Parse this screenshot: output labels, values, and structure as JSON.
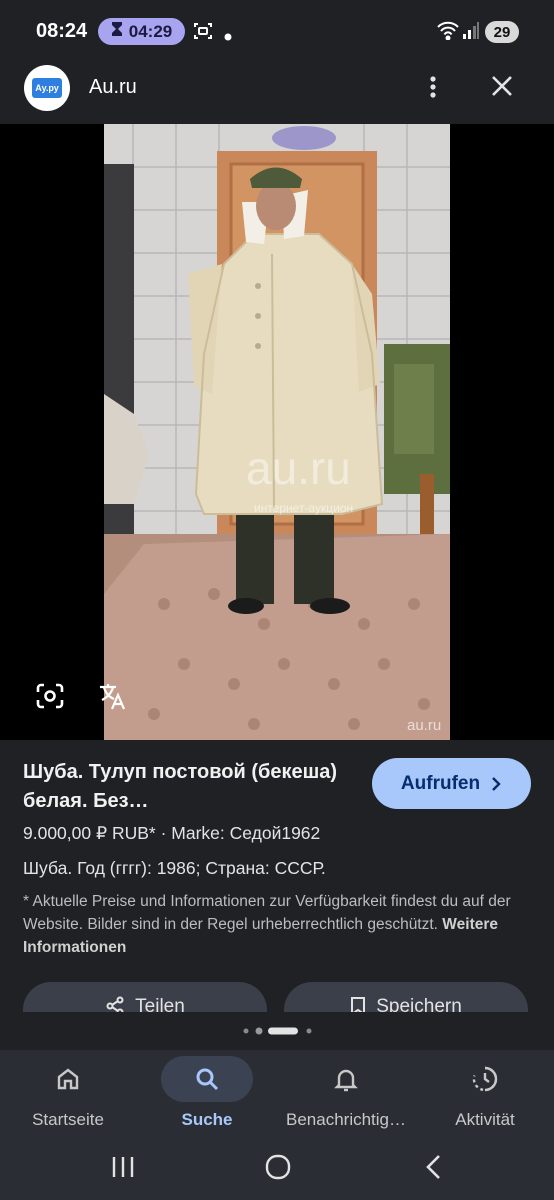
{
  "status_bar": {
    "time": "08:24",
    "timer": "04:29",
    "battery": "29"
  },
  "header": {
    "logo_text": "Ау.ру",
    "site_name": "Au.ru"
  },
  "photo": {
    "watermark": "au.ru",
    "watermark_sub": "интернет-аукцион",
    "corner_mark": "au.ru"
  },
  "result": {
    "title": "Шуба. Тулуп постовой (бекеша) белая. Без…",
    "open_button": "Aufrufen",
    "price_line": "9.000,00 ₽ RUB* · Marke: Седой1962",
    "description": "Шуба. Год (гггг): 1986; Страна: СССР.",
    "note": "* Aktuelle Preise und Informationen zur Verfügbarkeit findest du auf der Website. Bilder sind in der Regel urheberrechtlich geschützt.",
    "note_link": "Weitere Informationen",
    "share_button": "Teilen",
    "save_button": "Speichern"
  },
  "bottom_nav": [
    {
      "label": "Startseite",
      "icon": "home-icon",
      "active": false
    },
    {
      "label": "Suche",
      "icon": "search-icon",
      "active": true
    },
    {
      "label": "Benachrichtig…",
      "icon": "bell-icon",
      "active": false
    },
    {
      "label": "Aktivität",
      "icon": "activity-icon",
      "active": false
    }
  ],
  "colors": {
    "background": "#1f2124",
    "accent": "#a8c7fa",
    "timer_pill": "#a8a4f0"
  }
}
